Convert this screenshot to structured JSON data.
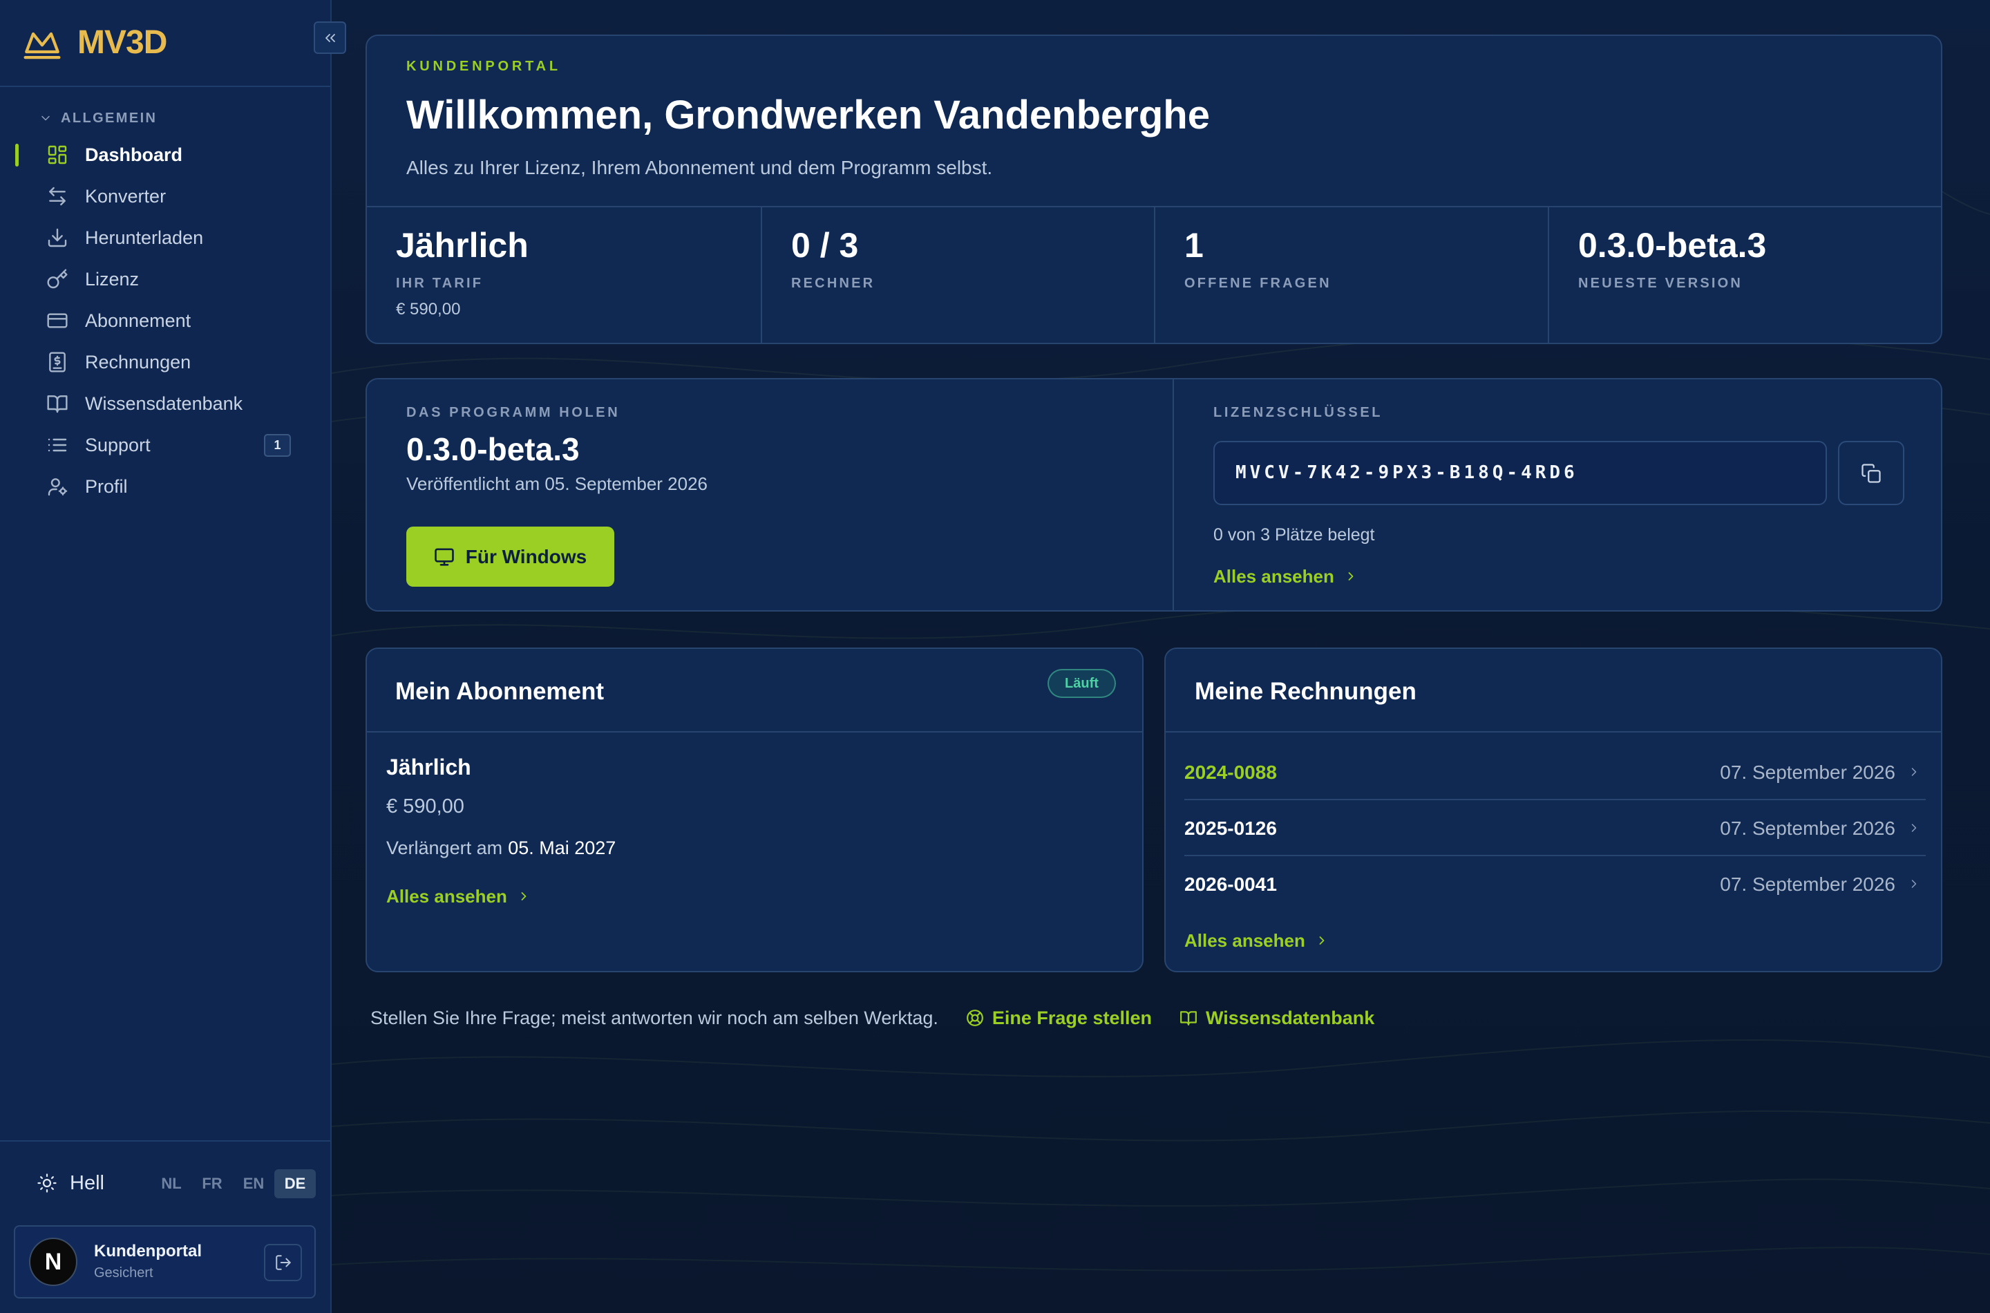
{
  "app": {
    "logo_text": "MV3D",
    "logo_icon": "crown-logo-icon"
  },
  "colors": {
    "accent": "#9ccf24",
    "background": "#0b1a33",
    "sidebar": "#0f2650",
    "card": "#0f2953",
    "logo": "#e8bb4f",
    "status_running": "#4fd1a5"
  },
  "sidebar": {
    "collapse_icon": "chevrons-left-icon",
    "section_label": "ALLGEMEIN",
    "items": [
      {
        "label": "Dashboard",
        "icon": "dashboard-icon",
        "active": true
      },
      {
        "label": "Konverter",
        "icon": "arrow-left-right-icon"
      },
      {
        "label": "Herunterladen",
        "icon": "download-icon"
      },
      {
        "label": "Lizenz",
        "icon": "key-icon"
      },
      {
        "label": "Abonnement",
        "icon": "credit-card-icon"
      },
      {
        "label": "Rechnungen",
        "icon": "receipt-icon"
      },
      {
        "label": "Wissensdatenbank",
        "icon": "book-open-icon"
      },
      {
        "label": "Support",
        "icon": "list-icon",
        "badge": "1"
      },
      {
        "label": "Profil",
        "icon": "user-cog-icon"
      }
    ],
    "theme": {
      "label": "Hell",
      "icon": "sun-icon"
    },
    "languages": [
      "NL",
      "FR",
      "EN",
      "DE"
    ],
    "active_language": "DE",
    "user": {
      "initial": "N",
      "name": "Kundenportal",
      "status": "Gesichert",
      "logout_icon": "log-out-icon"
    }
  },
  "welcome": {
    "eyebrow": "KUNDENPORTAL",
    "title": "Willkommen, Grondwerken Vandenberghe",
    "subtitle": "Alles zu Ihrer Lizenz, Ihrem Abonnement und dem Programm selbst."
  },
  "stats": [
    {
      "value": "Jährlich",
      "label": "IHR TARIF",
      "sub": "€ 590,00"
    },
    {
      "value": "0 / 3",
      "label": "RECHNER"
    },
    {
      "value": "1",
      "label": "OFFENE FRAGEN"
    },
    {
      "value": "0.3.0-beta.3",
      "label": "NEUESTE VERSION"
    }
  ],
  "download": {
    "eyebrow": "DAS PROGRAMM HOLEN",
    "version": "0.3.0-beta.3",
    "released": "Veröffentlicht am 05. September 2026",
    "button_label": "Für Windows",
    "button_icon": "monitor-icon"
  },
  "license": {
    "eyebrow": "LIZENZSCHLÜSSEL",
    "key": "MVCV-7K42-9PX3-B18Q-4RD6",
    "copy_icon": "copy-icon",
    "seats": "0 von 3 Plätze belegt",
    "view_all": "Alles ansehen"
  },
  "subscription": {
    "title": "Mein Abonnement",
    "status": "Läuft",
    "plan": "Jährlich",
    "price": "€ 590,00",
    "renewal_prefix": "Verlängert am",
    "renewal_date": "05. Mai 2027",
    "view_all": "Alles ansehen"
  },
  "invoices": {
    "title": "Meine Rechnungen",
    "rows": [
      {
        "number": "2024-0088",
        "date": "07. September 2026"
      },
      {
        "number": "2025-0126",
        "date": "07. September 2026"
      },
      {
        "number": "2026-0041",
        "date": "07. September 2026"
      }
    ],
    "view_all": "Alles ansehen"
  },
  "footer": {
    "text": "Stellen Sie Ihre Frage; meist antworten wir noch am selben Werktag.",
    "ask_label": "Eine Frage stellen",
    "ask_icon": "lifebuoy-icon",
    "kb_label": "Wissensdatenbank",
    "kb_icon": "book-open-icon"
  }
}
